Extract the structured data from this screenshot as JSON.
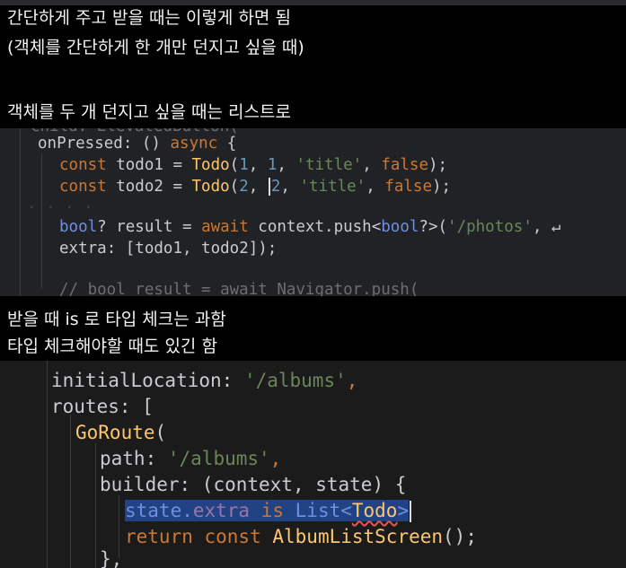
{
  "notes": {
    "line1": "간단하게 주고 받을 때는 이렇게 하면 됨",
    "line2": "(객체를 간단하게 한 개만 던지고 싶을 때)",
    "line3": "객체를 두 개 던지고 싶을 때는 리스트로",
    "line4": "받을 때 is 로 타입 체크는 과함",
    "line5": "타입 체크해야할 때도 있긴 함"
  },
  "code1": {
    "top_partial": "child: ElevatedButton(",
    "l1_name": "onPressed",
    "l1_rest": ": () ",
    "l1_async": "async",
    "l1_brace": " {",
    "l2_const": "const",
    "l2_var": " todo1 = ",
    "l2_cls": "Todo",
    "l2_open": "(",
    "l2_a": "1",
    "l2_sep": ", ",
    "l2_b": "1",
    "l2_sep2": ", ",
    "l2_str": "'title'",
    "l2_sep3": ", ",
    "l2_bool": "false",
    "l2_end": ");",
    "l3_const": "const",
    "l3_var": " todo2 = ",
    "l3_cls": "Todo",
    "l3_open": "(",
    "l3_a": "2",
    "l3_sep": ", ",
    "l3_b": "2",
    "l3_sep2": ", ",
    "l3_str": "'title'",
    "l3_sep3": ", ",
    "l3_bool": "false",
    "l3_end": ");",
    "l4_type": "bool",
    "l4_q": "? result = ",
    "l4_await": "await",
    "l4_call": " context.push<",
    "l4_generic": "bool",
    "l4_call2": "?>(",
    "l4_str": "'/photos'",
    "l4_tail": ", ↵",
    "l5_a": "extra",
    "l5_b": ": [todo1, todo2]);",
    "l6_comment": "// bool result = await Navigator.push("
  },
  "code2": {
    "l1_key": "initialLocation",
    "l1_colon": ": ",
    "l1_str": "'/albums'",
    "l1_end": ",",
    "l2_key": "routes",
    "l2_rest": ": [",
    "l3_cls": "GoRoute",
    "l3_open": "(",
    "l4_key": "path",
    "l4_colon": ": ",
    "l4_str": "'/albums'",
    "l4_end": ",",
    "l5_key": "builder",
    "l5_rest": ": (context, state) {",
    "l6_a": "state.",
    "l6_b": "extra",
    "l6_is": " is ",
    "l6_list": "List<",
    "l6_todo": "Todo",
    "l6_close": ">",
    "l7_ret": "return",
    "l7_const": " const ",
    "l7_cls": "AlbumListScreen",
    "l7_end": "();",
    "l8": "},"
  }
}
